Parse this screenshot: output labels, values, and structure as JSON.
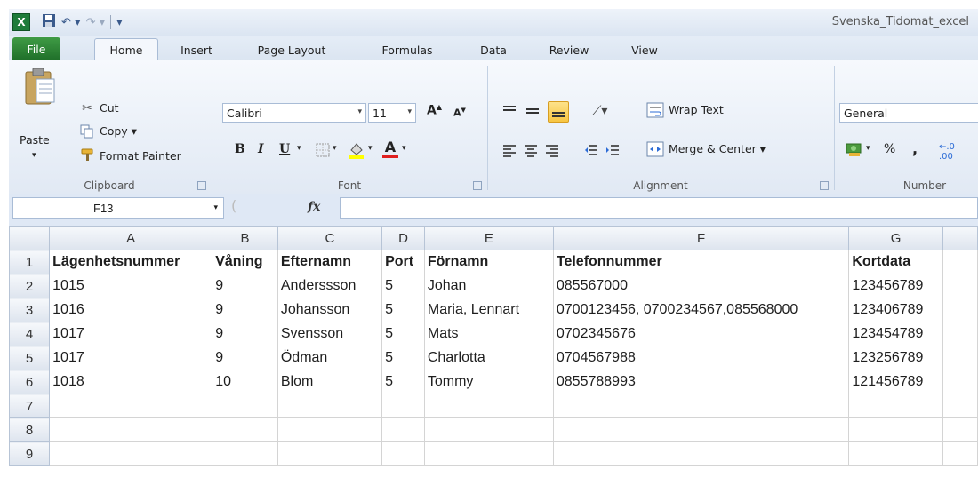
{
  "title": "Svenska_Tidomat_excel",
  "tabs": [
    "File",
    "Home",
    "Insert",
    "Page Layout",
    "Formulas",
    "Data",
    "Review",
    "View"
  ],
  "clipboard": {
    "label": "Clipboard",
    "paste": "Paste",
    "cut": "Cut",
    "copy": "Copy ▾",
    "format_painter": "Format Painter"
  },
  "font": {
    "label": "Font",
    "family": "Calibri",
    "size": "11"
  },
  "alignment": {
    "label": "Alignment",
    "wrap_text": "Wrap Text",
    "merge_center": "Merge & Center ▾"
  },
  "number": {
    "label": "Number",
    "format": "General",
    "percent": "%",
    "comma": ","
  },
  "formula_bar": {
    "name_box": "F13",
    "fx": "fx",
    "value": ""
  },
  "sheet": {
    "columns": [
      "A",
      "B",
      "C",
      "D",
      "E",
      "F",
      "G"
    ],
    "rows": [
      {
        "num": "1",
        "cells": [
          "Lägenhetsnummer",
          "Våning",
          "Efternamn",
          "Port",
          "Förnamn",
          "Telefonnummer",
          "Kortdata"
        ],
        "bold": true
      },
      {
        "num": "2",
        "cells": [
          "1015",
          "9",
          "Anderssson",
          "5",
          "Johan",
          "085567000",
          "123456789"
        ]
      },
      {
        "num": "3",
        "cells": [
          "1016",
          "9",
          "Johansson",
          "5",
          "Maria, Lennart",
          "0700123456, 0700234567,085568000",
          "123406789"
        ]
      },
      {
        "num": "4",
        "cells": [
          "1017",
          "9",
          "Svensson",
          "5",
          "Mats",
          "0702345676",
          "123454789"
        ]
      },
      {
        "num": "5",
        "cells": [
          "1017",
          "9",
          "Ödman",
          "5",
          "Charlotta",
          "0704567988",
          "123256789"
        ]
      },
      {
        "num": "6",
        "cells": [
          "1018",
          "10",
          "Blom",
          "5",
          "Tommy",
          "0855788993",
          "121456789"
        ]
      },
      {
        "num": "7",
        "cells": [
          "",
          "",
          "",
          "",
          "",
          "",
          ""
        ]
      },
      {
        "num": "8",
        "cells": [
          "",
          "",
          "",
          "",
          "",
          "",
          ""
        ]
      },
      {
        "num": "9",
        "cells": [
          "",
          "",
          "",
          "",
          "",
          "",
          ""
        ]
      }
    ]
  }
}
